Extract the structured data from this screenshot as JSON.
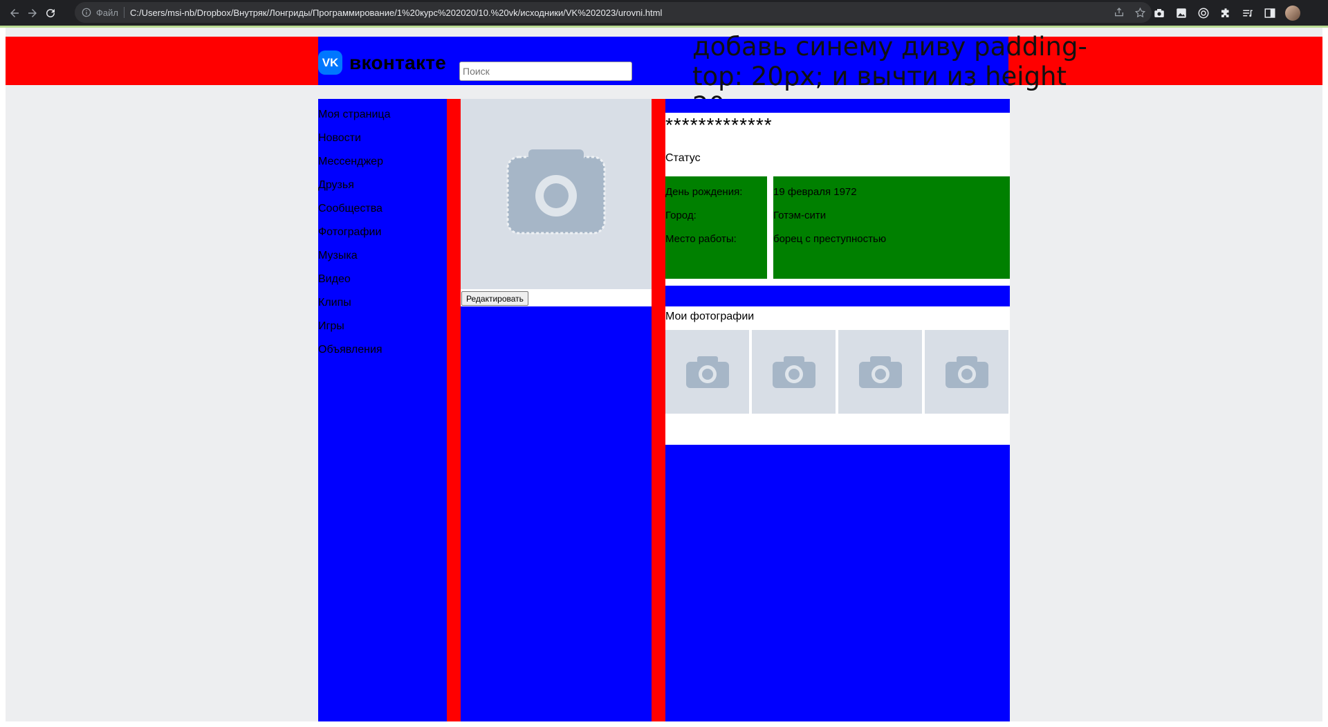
{
  "browser": {
    "file_label": "Файл",
    "url": "C:/Users/msi-nb/Dropbox/Внутряк/Лонгриды/Программирование/1%20курс%202020/10.%20vk/исходники/VK%202023/urovni.html"
  },
  "header": {
    "logo_text": "вконтакте",
    "logo_badge": "VK",
    "search_placeholder": "Поиск",
    "note": "добавь синему диву padding-top: 20px; и вычти из height 20px;"
  },
  "sidebar": {
    "items": [
      {
        "label": "Моя страница"
      },
      {
        "label": "Новости"
      },
      {
        "label": "Мессенджер"
      },
      {
        "label": "Друзья"
      },
      {
        "label": "Сообщества"
      },
      {
        "label": "Фотографии"
      },
      {
        "label": "Музыка"
      },
      {
        "label": "Видео"
      },
      {
        "label": "Клипы"
      },
      {
        "label": "Игры"
      },
      {
        "label": "Объявления"
      }
    ]
  },
  "avatar": {
    "edit_label": "Редактировать"
  },
  "profile": {
    "name": "*************",
    "status": "Статус",
    "info_labels": [
      "День рождения:",
      "Город:",
      "Место работы:"
    ],
    "info_values": [
      "19 февраля 1972",
      "Готэм-сити",
      "борец с преступностью"
    ]
  },
  "photos": {
    "title": "Мои фотографии"
  },
  "colors": {
    "header_bg": "#ff0000",
    "column_bg": "#0000ff",
    "gutter": "#ff0000",
    "info_bg": "#008000",
    "page_bg": "#edeef0"
  }
}
